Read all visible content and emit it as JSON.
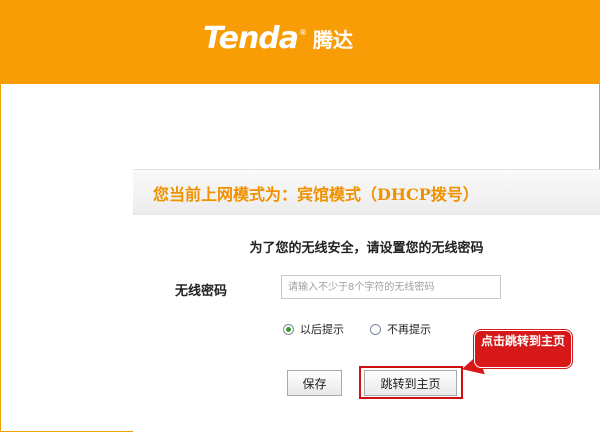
{
  "brand": {
    "logo_text": "Tenda",
    "logo_reg": "®",
    "logo_cn": "腾达"
  },
  "panel": {
    "title": "您当前上网模式为：宾馆模式（DHCP拨号）",
    "security_message": "为了您的无线安全，请设置您的无线密码",
    "password_label": "无线密码",
    "password_placeholder": "请输入不少于8个字符的无线密码",
    "password_value": "",
    "radio_options": [
      {
        "label": "以后提示",
        "checked": true
      },
      {
        "label": "不再提示",
        "checked": false
      }
    ],
    "save_label": "保存",
    "jump_label": "跳转到主页"
  },
  "annotation": {
    "callout_text": "点击跳转到主页"
  },
  "colors": {
    "header_bg": "#f99d06",
    "title_color": "#f09100",
    "highlight_red": "#d01010"
  }
}
